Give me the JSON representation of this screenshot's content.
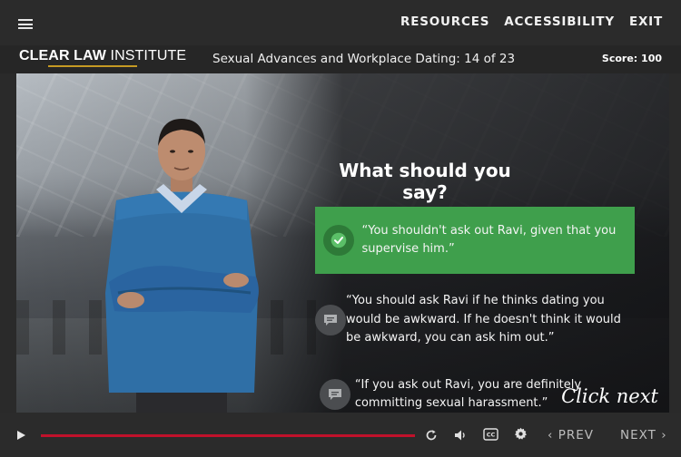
{
  "topbar": {
    "menu_icon": "hamburger-menu-icon",
    "links": [
      "RESOURCES",
      "ACCESSIBILITY",
      "EXIT"
    ]
  },
  "subheader": {
    "logo_bold": "CLEAR LAW",
    "logo_light": " INSTITUTE",
    "course_title": "Sexual Advances and Workplace Dating: 14 of 23",
    "score": "Score: 100"
  },
  "slide": {
    "question": "What should you say?",
    "options": [
      {
        "text": "“You shouldn't ask out Ravi, given that you supervise him.”",
        "icon": "check-icon",
        "state": "correct"
      },
      {
        "text": "“You should ask Ravi if he thinks dating you would be awkward. If he doesn't think it would be awkward, you can ask him out.”",
        "icon": "speech-bubble-icon",
        "state": "neutral"
      },
      {
        "text": "“If you ask out Ravi, you are definitely committing sexual harassment.”",
        "icon": "speech-bubble-icon",
        "state": "neutral"
      }
    ],
    "click_next": "Click next"
  },
  "player": {
    "progress": 1.0,
    "progress_color": "#c0112b",
    "accent_correct": "#3f9f4c",
    "prev_label": "PREV",
    "next_label": "NEXT",
    "icons": [
      "play-icon",
      "replay-icon",
      "volume-icon",
      "closed-captions-icon",
      "settings-gear-icon"
    ]
  }
}
